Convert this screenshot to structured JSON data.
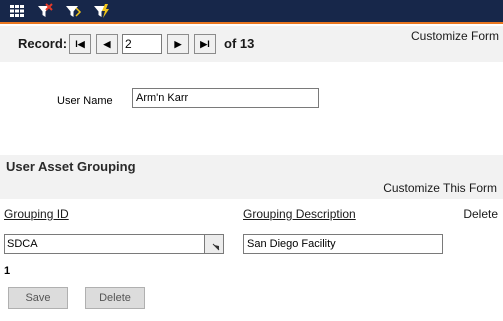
{
  "toolbar": {
    "icons": [
      "grid-icon",
      "clear-filter-icon",
      "filter-icon",
      "quick-filter-icon"
    ],
    "colors": {
      "background": "#17274a",
      "accent": "#e8761f"
    }
  },
  "record_nav": {
    "label": "Record:",
    "first": "H",
    "prev": "◀",
    "current": "2",
    "next": "▶",
    "last": "▶I",
    "of_text": "of 13",
    "customize_form": "Customize Form"
  },
  "user": {
    "label": "User Name",
    "value": "Arm'n Karr"
  },
  "grouping": {
    "title": "User Asset Grouping",
    "customize": "Customize This Form",
    "headers": {
      "id": "Grouping ID",
      "description": "Grouping Description",
      "delete": "Delete"
    },
    "row": {
      "id": "SDCA",
      "description": "San Diego Facility"
    },
    "count": "1"
  },
  "buttons": {
    "save": "Save",
    "delete": "Delete"
  }
}
